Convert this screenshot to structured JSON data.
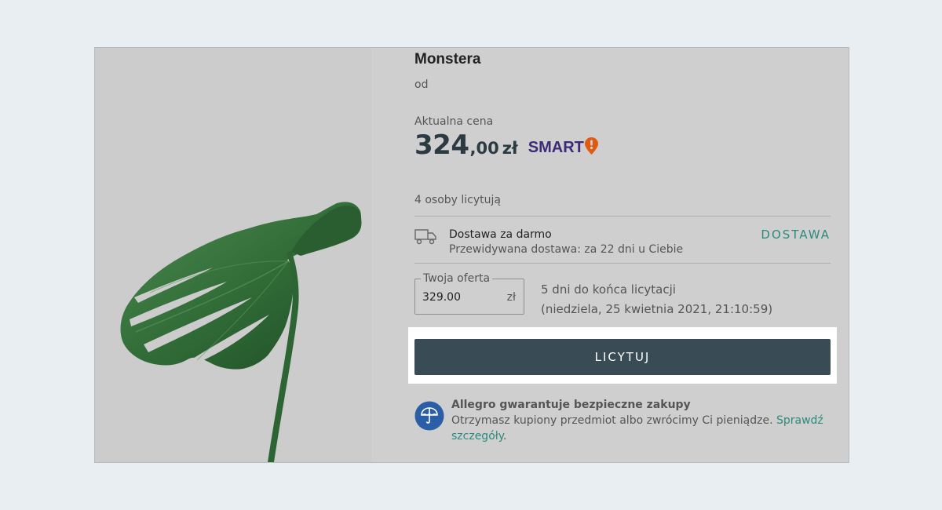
{
  "product": {
    "title": "Monstera",
    "seller_prefix": "od"
  },
  "price": {
    "label": "Aktualna cena",
    "integer": "324",
    "decimal": ",00",
    "currency": "zł",
    "smart_badge": "SMART",
    "smart_icon": "exclamation-pin-icon",
    "smart_color": "#3d2b7a",
    "smart_icon_color": "#e05a10"
  },
  "bidders": "4 osoby licytują",
  "delivery": {
    "icon": "truck-icon",
    "title": "Dostawa za darmo",
    "subtitle": "Przewidywana dostawa: za 22 dni u Ciebie",
    "link": "DOSTAWA"
  },
  "offer": {
    "label": "Twoja oferta",
    "value": "329.00",
    "currency": "zł"
  },
  "auction_end": {
    "remaining": "5 dni do końca licytacji",
    "date": "(niedziela, 25 kwietnia 2021, 21:10:59)"
  },
  "bid_button": "LICYTUJ",
  "guarantee": {
    "icon": "umbrella-icon",
    "title": "Allegro gwarantuje bezpieczne zakupy",
    "text": "Otrzymasz kupiony przedmiot albo zwrócimy Ci pieniądze.",
    "link_text": "Sprawdź szczegóły",
    "tail": "."
  },
  "colors": {
    "accent": "#2b8a7e",
    "button": "#394b55",
    "guarantee_icon": "#2a5ea7"
  }
}
